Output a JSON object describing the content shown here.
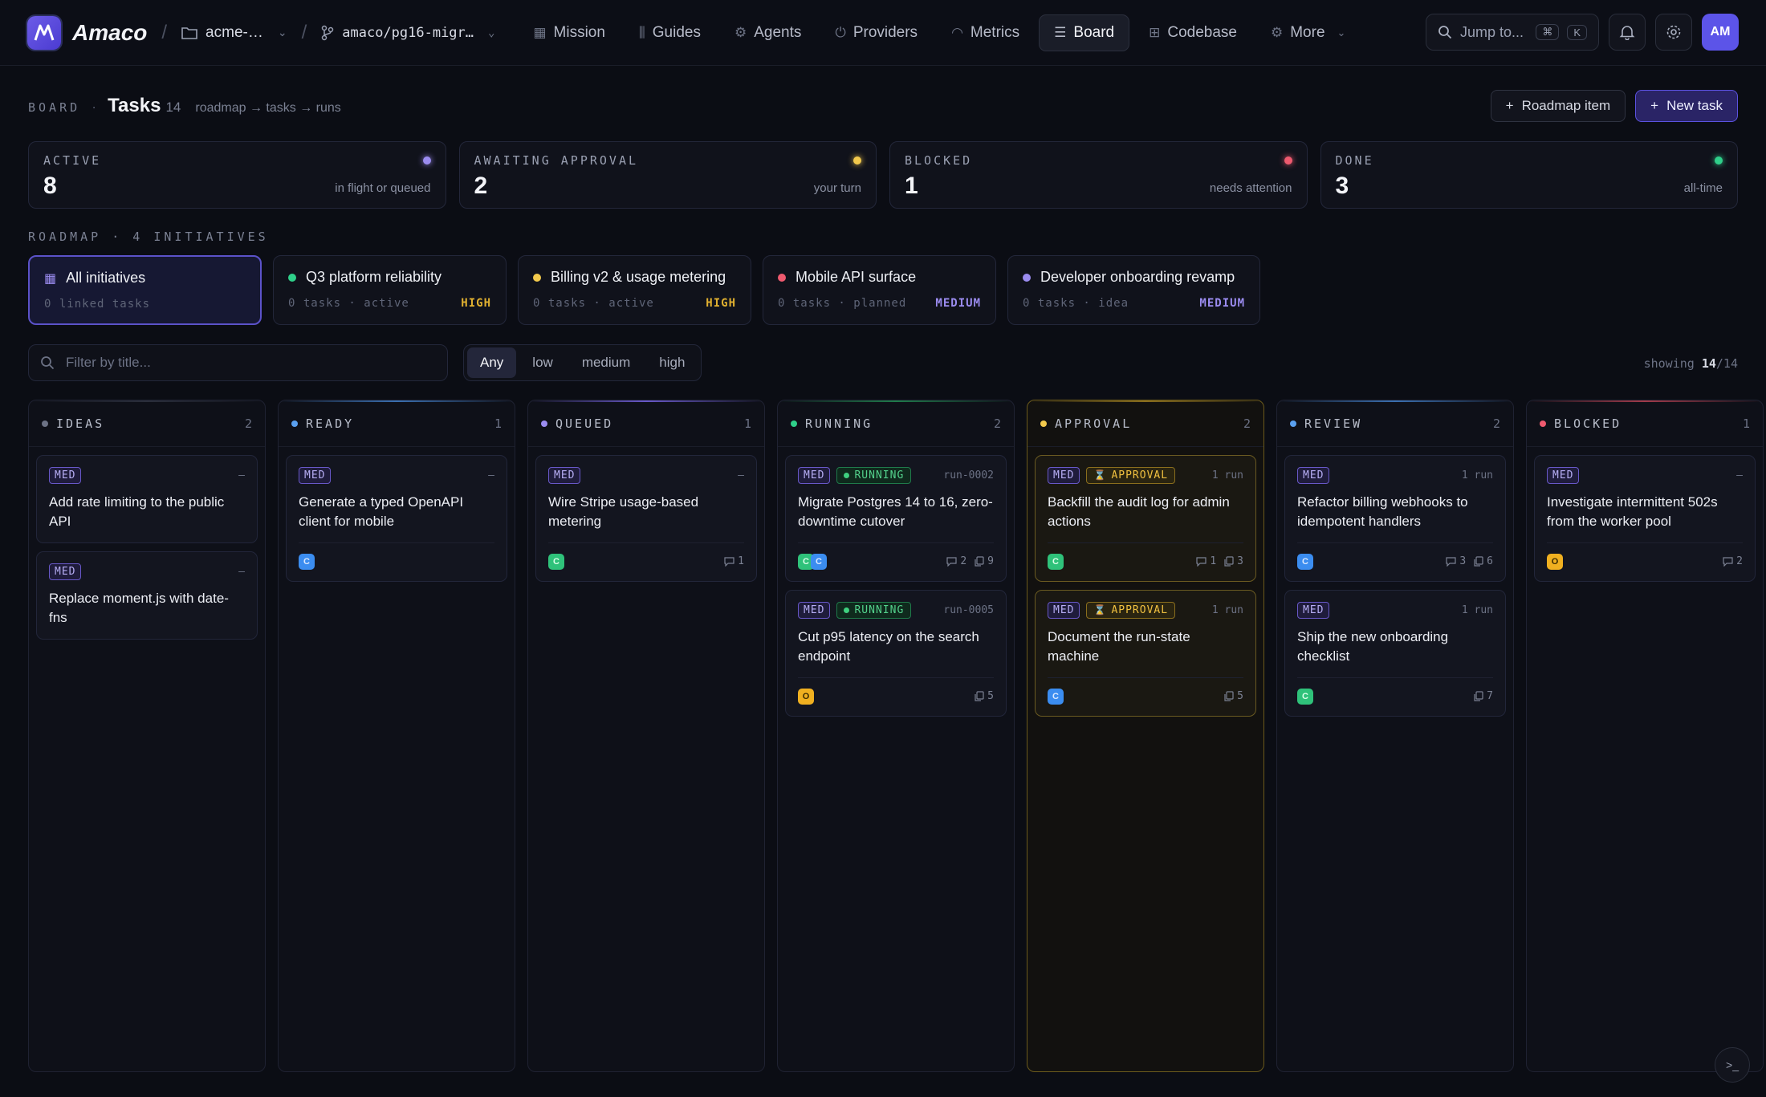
{
  "nav": {
    "brand": "Amaco",
    "workspace": "acme-…",
    "branch": "amaco/pg16-migr…",
    "items": [
      {
        "label": "Mission",
        "icon": "grid-icon"
      },
      {
        "label": "Guides",
        "icon": "books-icon"
      },
      {
        "label": "Agents",
        "icon": "chip-icon"
      },
      {
        "label": "Providers",
        "icon": "plug-icon"
      },
      {
        "label": "Metrics",
        "icon": "gauge-icon"
      },
      {
        "label": "Board",
        "icon": "checklist-icon",
        "active": true
      },
      {
        "label": "Codebase",
        "icon": "tree-icon"
      },
      {
        "label": "More",
        "icon": "gear-icon"
      }
    ],
    "jump_label": "Jump to...",
    "kbd1": "⌘",
    "kbd2": "K",
    "avatar": "AM"
  },
  "header": {
    "eyebrow": "BOARD",
    "title": "Tasks",
    "count": "14",
    "path": "roadmap → tasks → runs",
    "roadmap_button": "Roadmap item",
    "new_task_button": "New task"
  },
  "stats": [
    {
      "label": "ACTIVE",
      "value": "8",
      "note": "in flight or queued",
      "color": "#9b8cf0"
    },
    {
      "label": "AWAITING APPROVAL",
      "value": "2",
      "note": "your turn",
      "color": "#f2c94c"
    },
    {
      "label": "BLOCKED",
      "value": "1",
      "note": "needs attention",
      "color": "#ef5a6f"
    },
    {
      "label": "DONE",
      "value": "3",
      "note": "all-time",
      "color": "#2fd08a"
    }
  ],
  "roadmap": {
    "label": "ROADMAP · 4 INITIATIVES",
    "all": {
      "title": "All initiatives",
      "meta": "0 linked tasks"
    },
    "initiatives": [
      {
        "title": "Q3 platform reliability",
        "meta": "0 tasks · active",
        "priority": "HIGH",
        "dot": "#2fd08a",
        "prio_color": "#e0b030"
      },
      {
        "title": "Billing v2 & usage metering",
        "meta": "0 tasks · active",
        "priority": "HIGH",
        "dot": "#f2c94c",
        "prio_color": "#e0b030"
      },
      {
        "title": "Mobile API surface",
        "meta": "0 tasks · planned",
        "priority": "MEDIUM",
        "dot": "#ef5a6f",
        "prio_color": "#9b8cf0"
      },
      {
        "title": "Developer onboarding revamp",
        "meta": "0 tasks · idea",
        "priority": "MEDIUM",
        "dot": "#9b8cf0",
        "prio_color": "#9b8cf0"
      }
    ]
  },
  "filter": {
    "placeholder": "Filter by title...",
    "options": [
      "Any",
      "low",
      "medium",
      "high"
    ],
    "showing_prefix": "showing",
    "showing_count": "14",
    "showing_total": "/14"
  },
  "columns": [
    {
      "name": "IDEAS",
      "count": "2",
      "dot": "#6c7285",
      "top": "#2a2e3b",
      "cards": [
        {
          "tag": "MED",
          "meta": "–",
          "title": "Add rate limiting to the public API",
          "avatars": [],
          "stats": []
        },
        {
          "tag": "MED",
          "meta": "–",
          "title": "Replace moment.js with date-fns",
          "avatars": [],
          "stats": []
        }
      ]
    },
    {
      "name": "READY",
      "count": "1",
      "dot": "#5aa0f0",
      "top": "#3a6fb0",
      "cards": [
        {
          "tag": "MED",
          "meta": "–",
          "title": "Generate a typed OpenAPI client for mobile",
          "avatars": [
            "c"
          ],
          "stats": []
        }
      ]
    },
    {
      "name": "QUEUED",
      "count": "1",
      "dot": "#9b8cf0",
      "top": "#6858c8",
      "cards": [
        {
          "tag": "MED",
          "meta": "–",
          "title": "Wire Stripe usage-based metering",
          "avatars": [
            "g"
          ],
          "stats": [
            {
              "icon": "comment",
              "value": "1"
            }
          ]
        }
      ]
    },
    {
      "name": "RUNNING",
      "count": "2",
      "dot": "#2fd08a",
      "top": "#1f7a4a",
      "cards": [
        {
          "tag": "MED",
          "status": "RUNNING",
          "status_type": "running",
          "meta": "run-0002",
          "title": "Migrate Postgres 14 to 16, zero-downtime cutover",
          "avatars": [
            "g",
            "c"
          ],
          "stats": [
            {
              "icon": "comment",
              "value": "2"
            },
            {
              "icon": "file",
              "value": "9"
            }
          ]
        },
        {
          "tag": "MED",
          "status": "RUNNING",
          "status_type": "running",
          "meta": "run-0005",
          "title": "Cut p95 latency on the search endpoint",
          "avatars": [
            "o"
          ],
          "stats": [
            {
              "icon": "file",
              "value": "5"
            }
          ]
        }
      ]
    },
    {
      "name": "APPROVAL",
      "count": "2",
      "dot": "#f2c94c",
      "top": "#8a6e1d",
      "highlight": true,
      "cards": [
        {
          "tag": "MED",
          "status": "APPROVAL",
          "status_type": "approval",
          "meta": "1 run",
          "title": "Backfill the audit log for admin actions",
          "avatars": [
            "g"
          ],
          "stats": [
            {
              "icon": "comment",
              "value": "1"
            },
            {
              "icon": "file",
              "value": "3"
            }
          ],
          "approval": true
        },
        {
          "tag": "MED",
          "status": "APPROVAL",
          "status_type": "approval",
          "meta": "1 run",
          "title": "Document the run-state machine",
          "avatars": [
            "c"
          ],
          "stats": [
            {
              "icon": "file",
              "value": "5"
            }
          ],
          "approval": true
        }
      ]
    },
    {
      "name": "REVIEW",
      "count": "2",
      "dot": "#5aa0f0",
      "top": "#3a6fb0",
      "cards": [
        {
          "tag": "MED",
          "meta": "1 run",
          "title": "Refactor billing webhooks to idempotent handlers",
          "avatars": [
            "c"
          ],
          "stats": [
            {
              "icon": "comment",
              "value": "3"
            },
            {
              "icon": "file",
              "value": "6"
            }
          ]
        },
        {
          "tag": "MED",
          "meta": "1 run",
          "title": "Ship the new onboarding checklist",
          "avatars": [
            "g"
          ],
          "stats": [
            {
              "icon": "file",
              "value": "7"
            }
          ]
        }
      ]
    },
    {
      "name": "BLOCKED",
      "count": "1",
      "dot": "#ef5a6f",
      "top": "#a03a4a",
      "cards": [
        {
          "tag": "MED",
          "meta": "–",
          "title": "Investigate intermittent 502s from the worker pool",
          "avatars": [
            "o"
          ],
          "stats": [
            {
              "icon": "comment",
              "value": "2"
            }
          ]
        }
      ]
    }
  ],
  "avatar_letters": {
    "c": "C",
    "g": "C",
    "o": "O"
  }
}
